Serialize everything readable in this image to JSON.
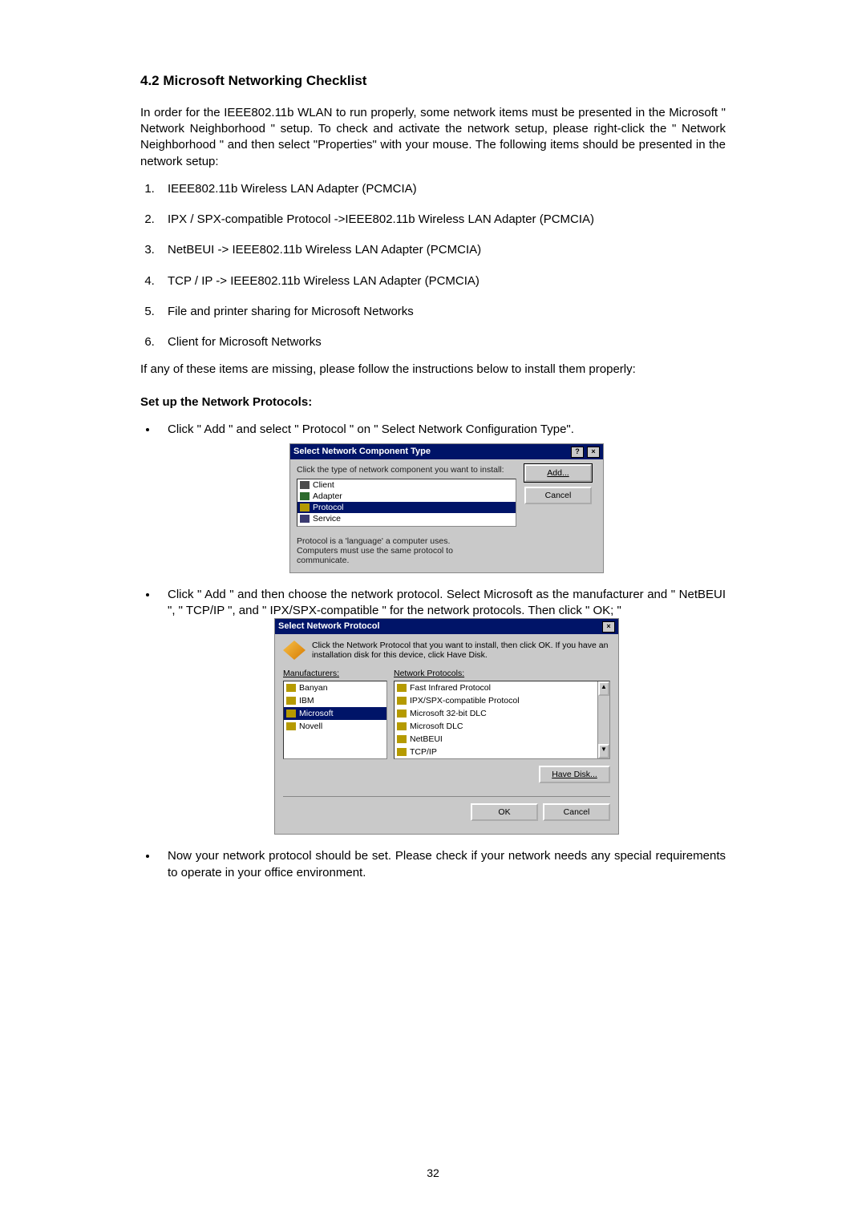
{
  "heading": "4.2 Microsoft Networking Checklist",
  "intro": "In order for the IEEE802.11b WLAN to run properly, some network items must be presented in the Microsoft \" Network Neighborhood \" setup. To check and activate the network setup, please right-click the \" Network Neighborhood \" and then select \"Properties\" with your mouse.  The following items should be presented in the network setup:",
  "checklist": [
    "IEEE802.11b Wireless LAN Adapter (PCMCIA)",
    "IPX / SPX-compatible Protocol ->IEEE802.11b Wireless LAN Adapter (PCMCIA)",
    "NetBEUI -> IEEE802.11b Wireless LAN Adapter (PCMCIA)",
    "TCP / IP -> IEEE802.11b Wireless LAN Adapter (PCMCIA)",
    "File and printer sharing for Microsoft Networks",
    "Client for Microsoft Networks"
  ],
  "missing": "If any of these items are missing, please follow the instructions below to install them properly:",
  "sub1": "Set up the Network Protocols:",
  "bullet1": "Click  \" Add \" and select  \" Protocol \" on \" Select Network Configuration Type\".",
  "dlg1": {
    "title": "Select Network Component Type",
    "cap": "Click the type of network component you want to install:",
    "items": {
      "client": "Client",
      "adapter": "Adapter",
      "protocol": "Protocol",
      "service": "Service"
    },
    "add": "Add...",
    "cancel": "Cancel",
    "hint": "Protocol is a 'language' a computer uses. Computers must use the same protocol to communicate."
  },
  "bullet2": "Click \" Add \" and then choose the network protocol. Select Microsoft as the manufacturer and  \" NetBEUI \",  \" TCP/IP \", and  \" IPX/SPX-compatible \" for the network protocols. Then click  \" OK; \"",
  "dlg2": {
    "title": "Select Network Protocol",
    "top": "Click the Network Protocol that you want to install, then click OK. If you have an installation disk for this device, click Have Disk.",
    "mfr_label": "Manufacturers:",
    "np_label": "Network Protocols:",
    "mfrs": [
      "Banyan",
      "IBM",
      "Microsoft",
      "Novell"
    ],
    "protocols": [
      "Fast Infrared Protocol",
      "IPX/SPX-compatible Protocol",
      "Microsoft 32-bit DLC",
      "Microsoft DLC",
      "NetBEUI",
      "TCP/IP"
    ],
    "have_disk": "Have Disk...",
    "ok": "OK",
    "cancel": "Cancel"
  },
  "bullet3": "Now your network protocol should be set.  Please check if your network needs any special requirements to operate in your office environment.",
  "pagenum": "32"
}
